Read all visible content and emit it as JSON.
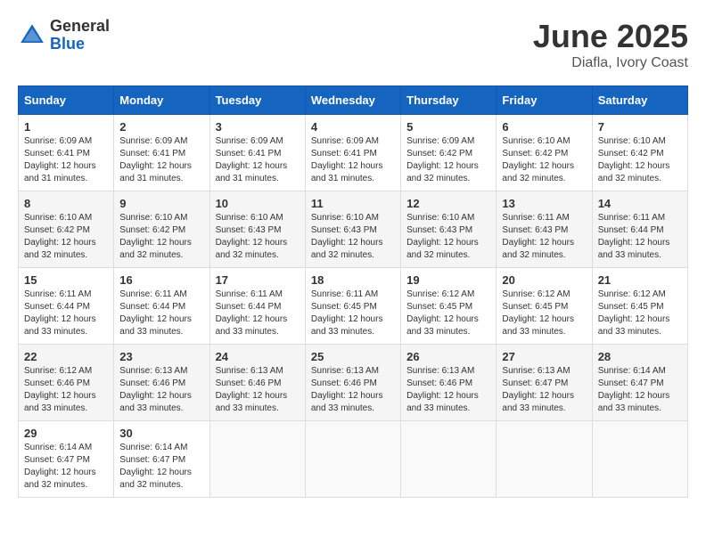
{
  "header": {
    "logo_general": "General",
    "logo_blue": "Blue",
    "title": "June 2025",
    "location": "Diafla, Ivory Coast"
  },
  "weekdays": [
    "Sunday",
    "Monday",
    "Tuesday",
    "Wednesday",
    "Thursday",
    "Friday",
    "Saturday"
  ],
  "weeks": [
    [
      {
        "day": "1",
        "sunrise": "6:09 AM",
        "sunset": "6:41 PM",
        "daylight": "12 hours and 31 minutes."
      },
      {
        "day": "2",
        "sunrise": "6:09 AM",
        "sunset": "6:41 PM",
        "daylight": "12 hours and 31 minutes."
      },
      {
        "day": "3",
        "sunrise": "6:09 AM",
        "sunset": "6:41 PM",
        "daylight": "12 hours and 31 minutes."
      },
      {
        "day": "4",
        "sunrise": "6:09 AM",
        "sunset": "6:41 PM",
        "daylight": "12 hours and 31 minutes."
      },
      {
        "day": "5",
        "sunrise": "6:09 AM",
        "sunset": "6:42 PM",
        "daylight": "12 hours and 32 minutes."
      },
      {
        "day": "6",
        "sunrise": "6:10 AM",
        "sunset": "6:42 PM",
        "daylight": "12 hours and 32 minutes."
      },
      {
        "day": "7",
        "sunrise": "6:10 AM",
        "sunset": "6:42 PM",
        "daylight": "12 hours and 32 minutes."
      }
    ],
    [
      {
        "day": "8",
        "sunrise": "6:10 AM",
        "sunset": "6:42 PM",
        "daylight": "12 hours and 32 minutes."
      },
      {
        "day": "9",
        "sunrise": "6:10 AM",
        "sunset": "6:42 PM",
        "daylight": "12 hours and 32 minutes."
      },
      {
        "day": "10",
        "sunrise": "6:10 AM",
        "sunset": "6:43 PM",
        "daylight": "12 hours and 32 minutes."
      },
      {
        "day": "11",
        "sunrise": "6:10 AM",
        "sunset": "6:43 PM",
        "daylight": "12 hours and 32 minutes."
      },
      {
        "day": "12",
        "sunrise": "6:10 AM",
        "sunset": "6:43 PM",
        "daylight": "12 hours and 32 minutes."
      },
      {
        "day": "13",
        "sunrise": "6:11 AM",
        "sunset": "6:43 PM",
        "daylight": "12 hours and 32 minutes."
      },
      {
        "day": "14",
        "sunrise": "6:11 AM",
        "sunset": "6:44 PM",
        "daylight": "12 hours and 33 minutes."
      }
    ],
    [
      {
        "day": "15",
        "sunrise": "6:11 AM",
        "sunset": "6:44 PM",
        "daylight": "12 hours and 33 minutes."
      },
      {
        "day": "16",
        "sunrise": "6:11 AM",
        "sunset": "6:44 PM",
        "daylight": "12 hours and 33 minutes."
      },
      {
        "day": "17",
        "sunrise": "6:11 AM",
        "sunset": "6:44 PM",
        "daylight": "12 hours and 33 minutes."
      },
      {
        "day": "18",
        "sunrise": "6:11 AM",
        "sunset": "6:45 PM",
        "daylight": "12 hours and 33 minutes."
      },
      {
        "day": "19",
        "sunrise": "6:12 AM",
        "sunset": "6:45 PM",
        "daylight": "12 hours and 33 minutes."
      },
      {
        "day": "20",
        "sunrise": "6:12 AM",
        "sunset": "6:45 PM",
        "daylight": "12 hours and 33 minutes."
      },
      {
        "day": "21",
        "sunrise": "6:12 AM",
        "sunset": "6:45 PM",
        "daylight": "12 hours and 33 minutes."
      }
    ],
    [
      {
        "day": "22",
        "sunrise": "6:12 AM",
        "sunset": "6:46 PM",
        "daylight": "12 hours and 33 minutes."
      },
      {
        "day": "23",
        "sunrise": "6:13 AM",
        "sunset": "6:46 PM",
        "daylight": "12 hours and 33 minutes."
      },
      {
        "day": "24",
        "sunrise": "6:13 AM",
        "sunset": "6:46 PM",
        "daylight": "12 hours and 33 minutes."
      },
      {
        "day": "25",
        "sunrise": "6:13 AM",
        "sunset": "6:46 PM",
        "daylight": "12 hours and 33 minutes."
      },
      {
        "day": "26",
        "sunrise": "6:13 AM",
        "sunset": "6:46 PM",
        "daylight": "12 hours and 33 minutes."
      },
      {
        "day": "27",
        "sunrise": "6:13 AM",
        "sunset": "6:47 PM",
        "daylight": "12 hours and 33 minutes."
      },
      {
        "day": "28",
        "sunrise": "6:14 AM",
        "sunset": "6:47 PM",
        "daylight": "12 hours and 33 minutes."
      }
    ],
    [
      {
        "day": "29",
        "sunrise": "6:14 AM",
        "sunset": "6:47 PM",
        "daylight": "12 hours and 32 minutes."
      },
      {
        "day": "30",
        "sunrise": "6:14 AM",
        "sunset": "6:47 PM",
        "daylight": "12 hours and 32 minutes."
      },
      null,
      null,
      null,
      null,
      null
    ]
  ]
}
